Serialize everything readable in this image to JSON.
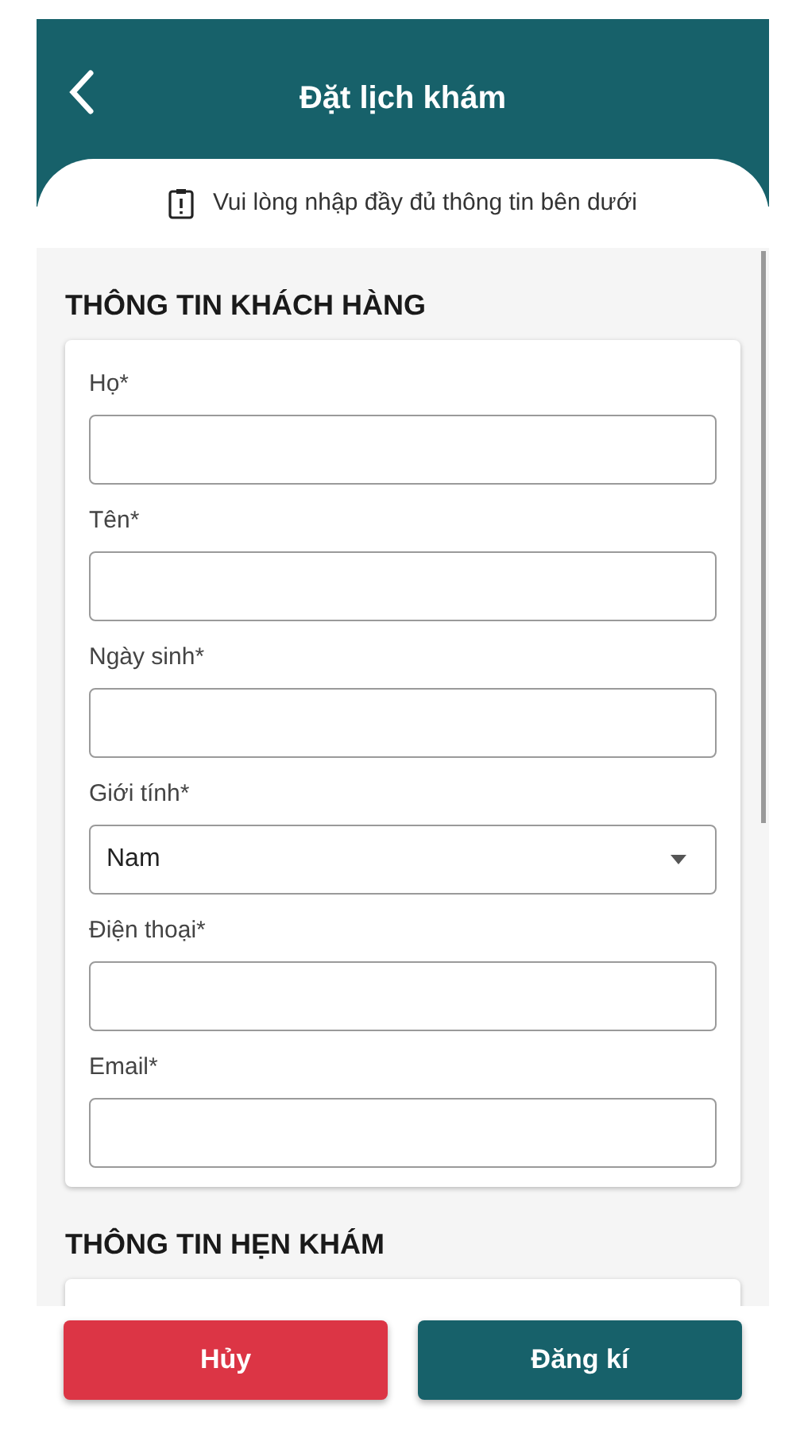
{
  "header": {
    "title": "Đặt lịch khám"
  },
  "notice": "Vui lòng nhập đầy đủ thông tin bên dưới",
  "sections": [
    {
      "title": "THÔNG TIN KHÁCH HÀNG",
      "fields": [
        {
          "kind": "text",
          "label": "Họ*"
        },
        {
          "kind": "text",
          "label": "Tên*"
        },
        {
          "kind": "text",
          "label": "Ngày sinh*"
        },
        {
          "kind": "select",
          "label": "Giới tính*",
          "value": "Nam"
        },
        {
          "kind": "text",
          "label": "Điện thoại*"
        },
        {
          "kind": "text",
          "label": "Email*"
        }
      ]
    },
    {
      "title": "THÔNG TIN HẸN KHÁM"
    }
  ],
  "buttons": [
    {
      "kind": "cancel",
      "label": "Hủy"
    },
    {
      "kind": "submit",
      "label": "Đăng kí"
    }
  ]
}
